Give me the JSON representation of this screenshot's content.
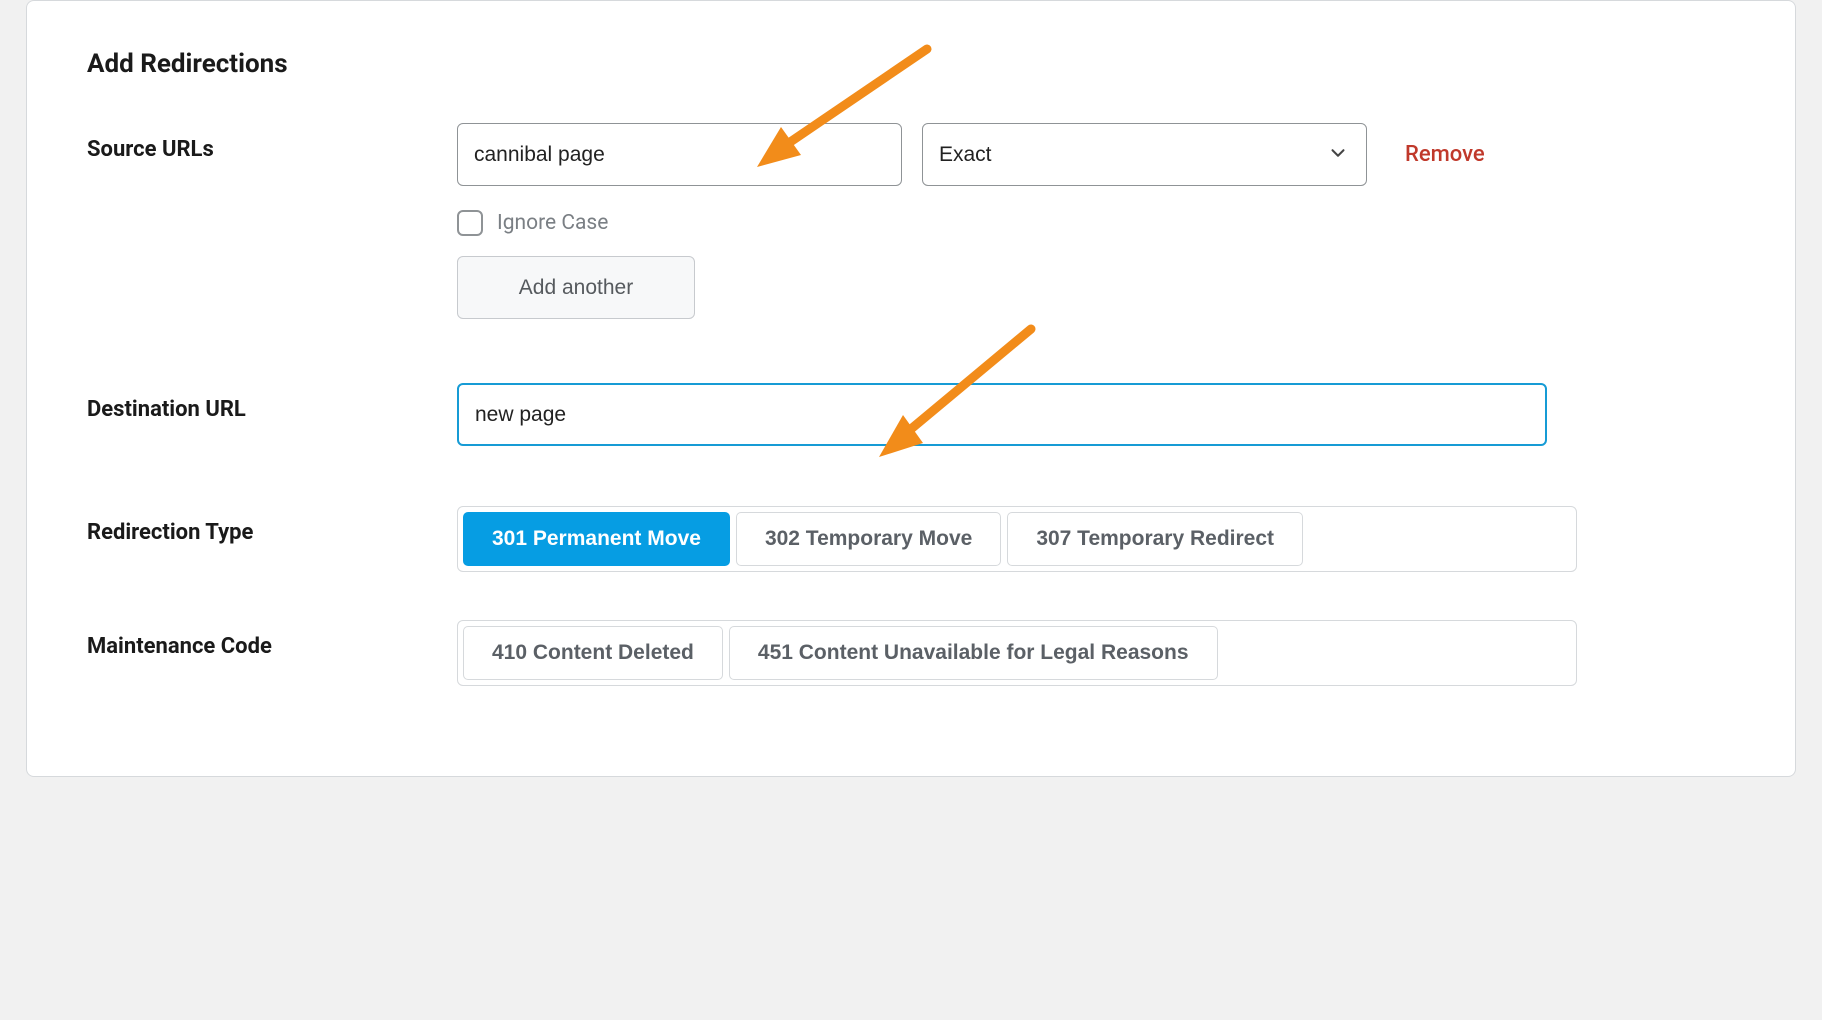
{
  "section_title": "Add Redirections",
  "source": {
    "label": "Source URLs",
    "input_value": "cannibal page",
    "match_selected": "Exact",
    "remove_label": "Remove",
    "ignore_case_label": "Ignore Case",
    "ignore_case_checked": false,
    "add_another_label": "Add another"
  },
  "destination": {
    "label": "Destination URL",
    "input_value": "new page"
  },
  "redirection_type": {
    "label": "Redirection Type",
    "options": [
      {
        "label": "301 Permanent Move",
        "active": true
      },
      {
        "label": "302 Temporary Move",
        "active": false
      },
      {
        "label": "307 Temporary Redirect",
        "active": false
      }
    ]
  },
  "maintenance_code": {
    "label": "Maintenance Code",
    "options": [
      {
        "label": "410 Content Deleted",
        "active": false
      },
      {
        "label": "451 Content Unavailable for Legal Reasons",
        "active": false
      }
    ]
  },
  "annotation_color": "#f28c1a"
}
